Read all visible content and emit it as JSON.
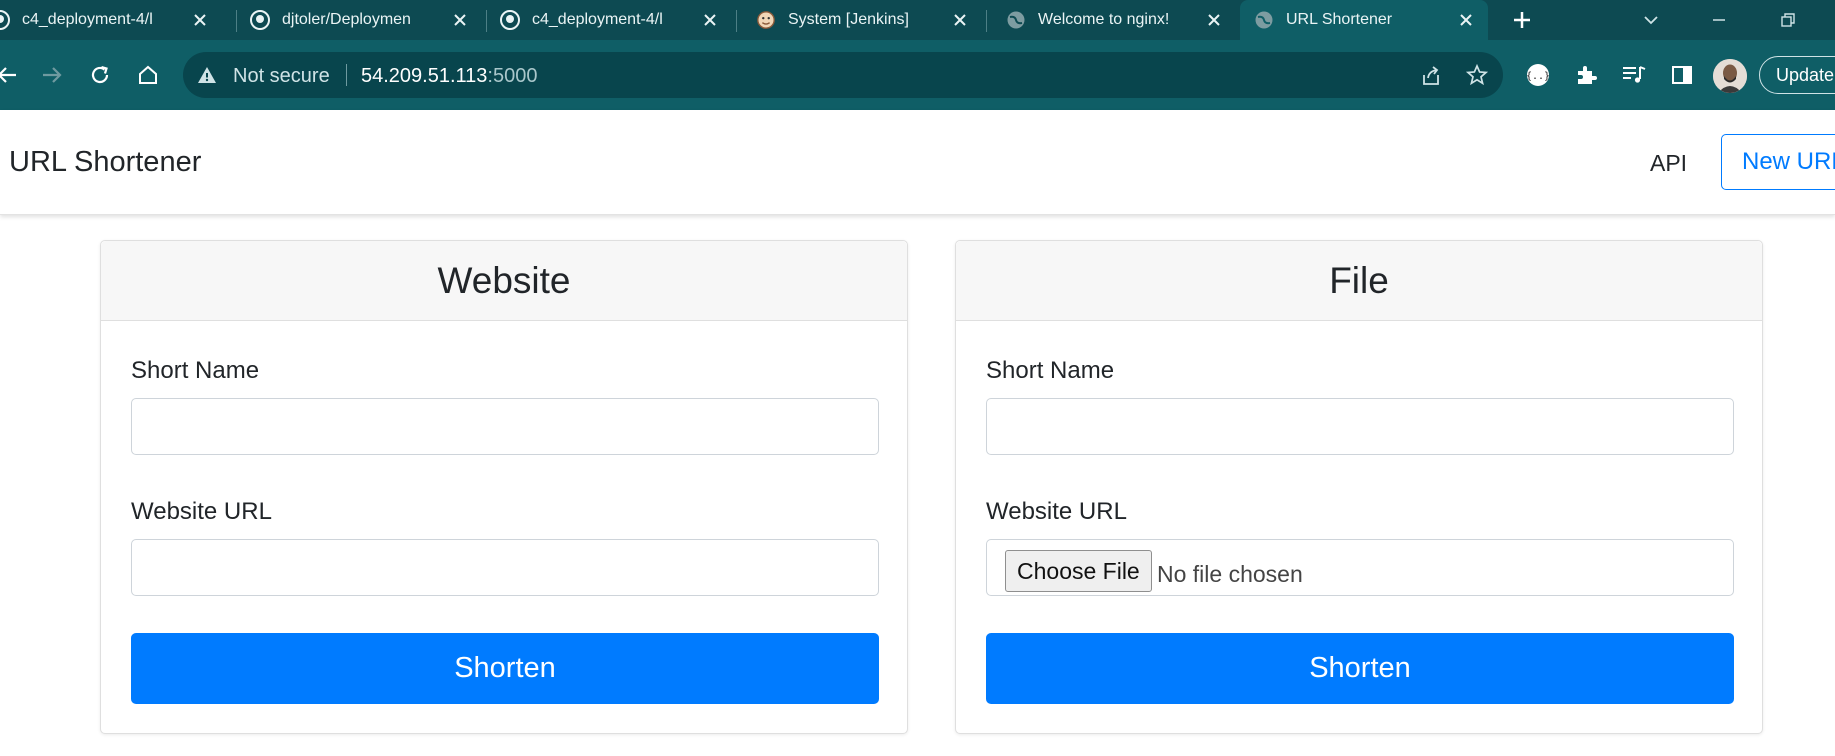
{
  "browser": {
    "tabs": [
      {
        "title": "c4_deployment-4/l",
        "icon": "github-icon",
        "active": false
      },
      {
        "title": "djtoler/Deploymen",
        "icon": "github-icon",
        "active": false
      },
      {
        "title": "c4_deployment-4/l",
        "icon": "github-icon",
        "active": false
      },
      {
        "title": "System [Jenkins]",
        "icon": "jenkins-icon",
        "active": false
      },
      {
        "title": "Welcome to nginx!",
        "icon": "globe-icon",
        "active": false
      },
      {
        "title": "URL Shortener",
        "icon": "globe-icon",
        "active": true
      }
    ],
    "security_label": "Not secure",
    "url_host": "54.209.51.113",
    "url_port": ":5000",
    "update_label": "Update"
  },
  "navbar": {
    "brand": "URL Shortener",
    "api_link": "API",
    "new_url_button": "New URL"
  },
  "cards": [
    {
      "header": "Website",
      "short_name_label": "Short Name",
      "short_name_value": "",
      "url_label": "Website URL",
      "url_value": "",
      "submit_label": "Shorten"
    },
    {
      "header": "File",
      "short_name_label": "Short Name",
      "short_name_value": "",
      "url_label": "Website URL",
      "file_button_label": "Choose File",
      "file_status": "No file chosen",
      "submit_label": "Shorten"
    }
  ],
  "colors": {
    "chrome_dark": "#0d4a52",
    "chrome_toolbar": "#0f5e66",
    "primary": "#007bff"
  }
}
